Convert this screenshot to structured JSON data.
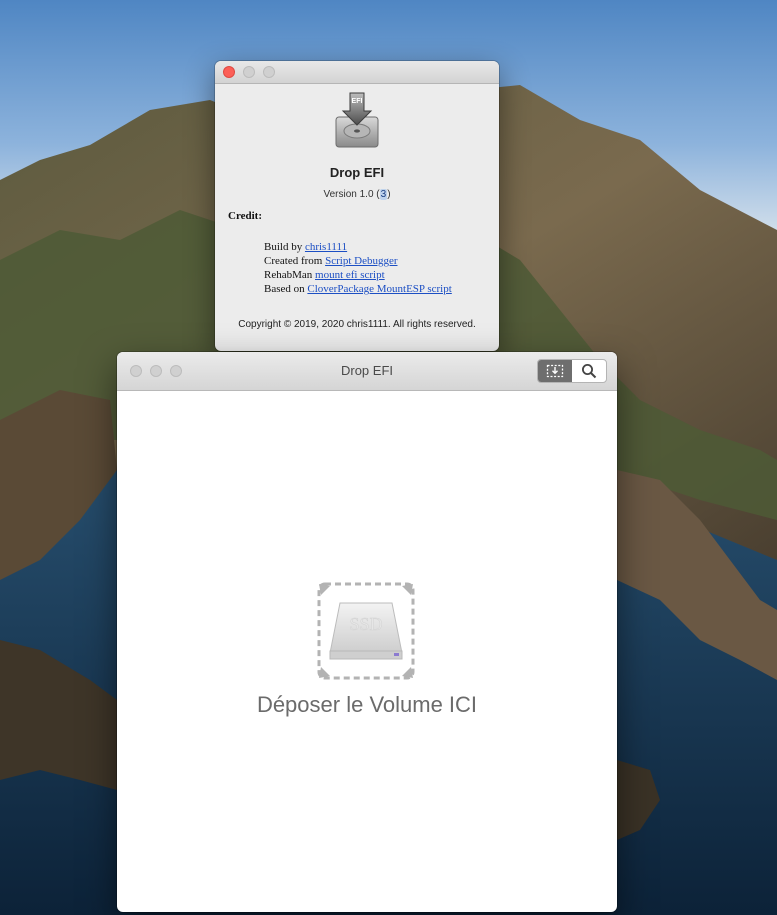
{
  "about_window": {
    "app_name": "Drop EFI",
    "version_prefix": "Version 1.0 (",
    "version_build": "3",
    "version_suffix": ")",
    "credit_heading": "Credit:",
    "credits": [
      {
        "prefix": "Build by ",
        "link": "chris1111"
      },
      {
        "prefix": "Created from ",
        "link": "Script Debugger"
      },
      {
        "prefix": "RehabMan ",
        "link": "mount efi script"
      },
      {
        "prefix": "Based on ",
        "link": "CloverPackage MountESP script"
      }
    ],
    "copyright": "Copyright © 2019, 2020 chris1111. All rights reserved.",
    "icon_label": "EFI"
  },
  "main_window": {
    "title": "Drop EFI",
    "toolbar": {
      "drop_icon": "drop-target-icon",
      "search_icon": "search-icon"
    },
    "drop_icon_label": "SSD",
    "drop_label": "Déposer le Volume ICI"
  },
  "colors": {
    "link": "#1c4fc4",
    "close": "#fc5f57",
    "active_segment": "#6e6e6e"
  }
}
